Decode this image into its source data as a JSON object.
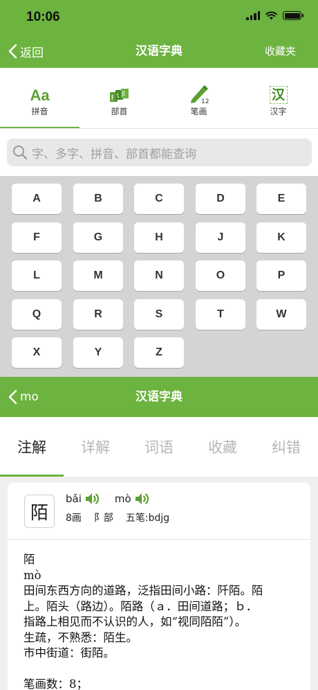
{
  "status": {
    "time": "10:06"
  },
  "top_nav": {
    "back_label": "返回",
    "title": "汉语字典",
    "right_label": "收藏夹"
  },
  "modes": [
    {
      "label": "拼音",
      "icon": "pinyin-icon"
    },
    {
      "label": "部首",
      "icon": "radical-icon"
    },
    {
      "label": "笔画",
      "icon": "stroke-pencil-icon"
    },
    {
      "label": "汉字",
      "icon": "hanzi-icon"
    }
  ],
  "search": {
    "placeholder": "字、多字、拼音、部首都能查询"
  },
  "letters": [
    "A",
    "B",
    "C",
    "D",
    "E",
    "F",
    "G",
    "H",
    "J",
    "K",
    "L",
    "M",
    "N",
    "O",
    "P",
    "Q",
    "R",
    "S",
    "T",
    "W",
    "X",
    "Y",
    "Z"
  ],
  "detail_nav": {
    "back_label": "mo",
    "title": "汉语字典"
  },
  "detail_tabs": [
    "注解",
    "详解",
    "词语",
    "收藏",
    "纠错"
  ],
  "entry": {
    "character": "陌",
    "pron1": "bǎi",
    "pron2": "mò",
    "strokes": "8画",
    "radical": "阝部",
    "wubi": "五笔:bdjg",
    "lines": [
      "陌",
      "mò",
      "田间东西方向的道路，泛指田间小路：阡陌。陌",
      "上。陌头（路边）。陌路（ａ．田间道路；ｂ．",
      "指路上相见而不认识的人，如“视同陌陌”）。",
      "生疏，不熟悉：陌生。",
      "市中街道：街陌。",
      "",
      "笔画数：8；"
    ]
  },
  "colors": {
    "brand_green": "#6cb33f",
    "keypad_bg": "#d4d4d4",
    "content_bg": "#efefef"
  }
}
